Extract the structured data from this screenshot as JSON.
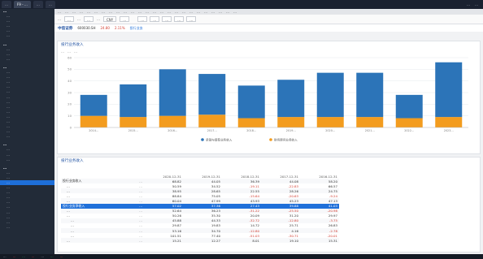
{
  "tabs": [
    "…",
    "F9 - …",
    "…",
    "…"
  ],
  "tab_right": [
    "…",
    "…"
  ],
  "sidebar": {
    "sections": [
      {
        "label": "…",
        "bold": true,
        "items": [
          "…",
          "…",
          "…",
          "…",
          "…"
        ]
      },
      {
        "label": "…",
        "bold": true,
        "items": [
          "…",
          "…",
          "…"
        ]
      },
      {
        "label": "…",
        "bold": true,
        "items": [
          "…",
          "…",
          "…",
          "…",
          "…",
          "…",
          "…",
          "…",
          "…",
          "…",
          "…",
          "…",
          "…",
          "…"
        ]
      },
      {
        "label": "…",
        "bold": true,
        "items": [
          "…",
          "…",
          "…"
        ]
      },
      {
        "label": "…",
        "bold": true,
        "items": [
          "…",
          "…",
          "…",
          "…",
          "…",
          "…",
          "…",
          "…",
          "…",
          "…",
          "…",
          "…"
        ]
      }
    ],
    "selected_item": "…"
  },
  "menubar": [
    "…",
    "…",
    "…",
    "…",
    "…",
    "…",
    "…",
    "…",
    "…",
    "…",
    "…",
    "…",
    "…",
    "…",
    "…",
    "…",
    "…",
    "…",
    "…",
    "…",
    "…",
    "…",
    "…",
    "…",
    "…"
  ],
  "toolbar": {
    "period_label": "…",
    "period_value": "…",
    "report_type_label": "…",
    "report_type_value": "…",
    "currency_label": "…",
    "currency_value": "CNY",
    "standard_value": "…",
    "buttons": [
      "…",
      "…",
      "…",
      "…",
      "…"
    ]
  },
  "stock": {
    "name": "中信证券",
    "code": "600030.SH",
    "price": "24.80",
    "change": "2.11%",
    "tag": "投行业务"
  },
  "chart_panel": {
    "title": "投行业务收入",
    "subtitle": "投行业务净收入",
    "subtabs": [
      "…",
      "…",
      "…"
    ]
  },
  "chart_data": {
    "type": "bar",
    "stacked": true,
    "categories": [
      "2014…",
      "2015…",
      "2016…",
      "2017…",
      "2018…",
      "2019…",
      "2020…",
      "2021…",
      "2022…",
      "2023…"
    ],
    "series": [
      {
        "name": "财务顾问业务收入",
        "color": "#f39c1e",
        "values": [
          10,
          9,
          10,
          11,
          8,
          9,
          9,
          9,
          8,
          9
        ]
      },
      {
        "name": "承销与保荐业务收入",
        "color": "#2c74b8",
        "values": [
          18,
          28,
          40,
          35,
          28,
          32,
          38,
          38,
          20,
          47
        ]
      }
    ],
    "ylim": [
      0,
      60
    ],
    "yticks": [
      0,
      10,
      20,
      30,
      40,
      50,
      60
    ],
    "legend_position": "bottom",
    "grid": true
  },
  "table_panel": {
    "title": "投行业务收入",
    "columns": [
      "2020-12-31",
      "2019-12-31",
      "2018-12-31",
      "2017-12-31",
      "2016-12-31"
    ],
    "rows": [
      {
        "label": "投行业务收入",
        "unit": "…",
        "values": [
          "68.82",
          "44.05",
          "36.39",
          "44.08",
          "58.20"
        ],
        "level": 0
      },
      {
        "label": "…",
        "unit": "…",
        "values": [
          "50.59",
          "34.52",
          "-19.11",
          "-22.83",
          "66.57"
        ],
        "level": 1
      },
      {
        "label": "…",
        "unit": "…",
        "values": [
          "38.95",
          "28.65",
          "22.55",
          "28.26",
          "24.75"
        ],
        "level": 1
      },
      {
        "label": "…",
        "unit": "…",
        "values": [
          "88.84",
          "75.05",
          "-15.64",
          "-20.63",
          "-9.24"
        ],
        "level": 1
      },
      {
        "label": "…",
        "unit": "…",
        "values": [
          "60.04",
          "47.99",
          "43.93",
          "45.23",
          "47.13"
        ],
        "level": 1
      },
      {
        "label": "投行业务净收入",
        "unit": "…",
        "values": [
          "57.02",
          "37.36",
          "27.43",
          "39.88",
          "41.03"
        ],
        "level": 0,
        "selected": true
      },
      {
        "label": "…",
        "unit": "…",
        "values": [
          "52.64",
          "36.23",
          "-31.22",
          "-25.50",
          "-20.98"
        ],
        "level": 1
      },
      {
        "label": "…",
        "unit": "…",
        "values": [
          "50.26",
          "35.30",
          "20.09",
          "31.20",
          "29.97"
        ],
        "level": 1
      },
      {
        "label": "…",
        "unit": "…",
        "values": [
          "45.88",
          "44.33",
          "-32.72",
          "-12.80",
          "-3.75"
        ],
        "level": 2
      },
      {
        "label": "…",
        "unit": "…",
        "values": [
          "29.87",
          "19.83",
          "14.72",
          "25.71",
          "26.83"
        ],
        "level": 2
      },
      {
        "label": "…",
        "unit": "…",
        "values": [
          "53.16",
          "34.70",
          "-12.80",
          "4.16",
          "-2.78"
        ],
        "level": 2
      },
      {
        "label": "…",
        "unit": "…",
        "values": [
          "101.51",
          "77.40",
          "-51.03",
          "-30.71",
          "-20.01"
        ],
        "level": 2
      },
      {
        "label": "…",
        "unit": "…",
        "values": [
          "15.21",
          "12.27",
          "8.01",
          "19.10",
          "15.31"
        ],
        "level": 1
      }
    ]
  },
  "statusbar": [
    {
      "text": "…",
      "cls": ""
    },
    {
      "text": "…",
      "cls": "red"
    },
    {
      "text": "…",
      "cls": "green"
    },
    {
      "text": "…",
      "cls": "red"
    },
    {
      "text": "…",
      "cls": ""
    },
    {
      "text": "…",
      "cls": "green"
    },
    {
      "text": "…",
      "cls": "red"
    }
  ],
  "colors": {
    "accent": "#1e6fd9",
    "negative": "#d23b2f",
    "sidebar": "#222b38"
  }
}
